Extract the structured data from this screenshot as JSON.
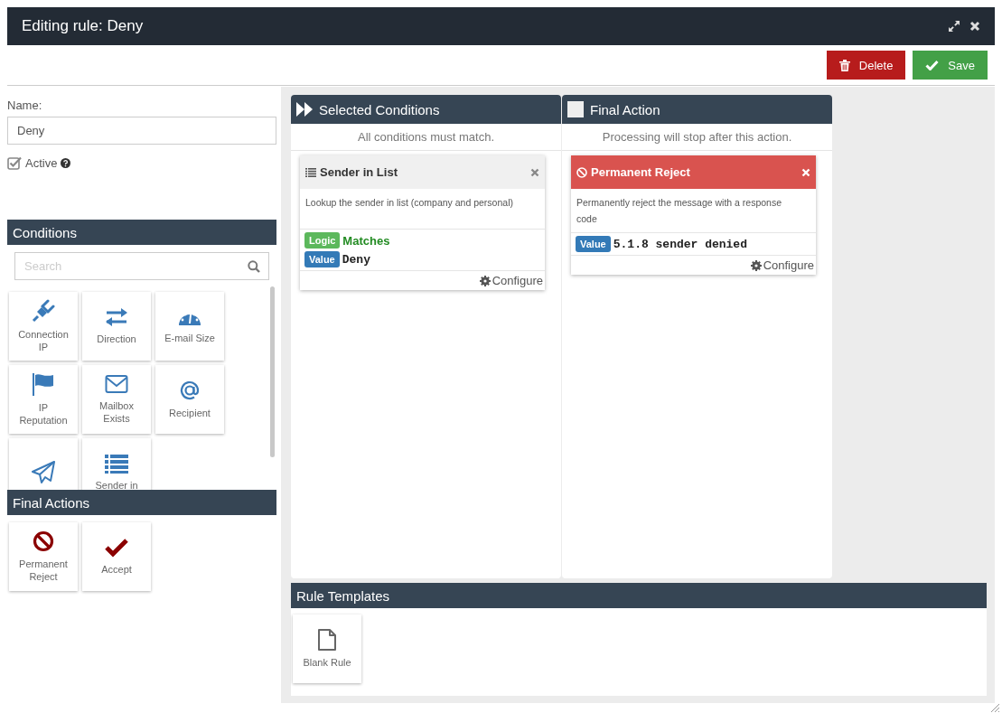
{
  "window": {
    "title": "Editing rule: Deny"
  },
  "toolbar": {
    "buttons": [
      {
        "label": "Delete",
        "kind": "danger"
      },
      {
        "label": "Save",
        "kind": "success"
      }
    ]
  },
  "form": {
    "name_label": "Name:",
    "name_value": "Deny",
    "active": {
      "label": "Active",
      "checked": true
    }
  },
  "conditions_panel": {
    "title": "Conditions",
    "search": {
      "placeholder": "Search"
    },
    "items": [
      {
        "label": "Connection IP",
        "label_hidden": false
      },
      {
        "label": "Direction",
        "label_hidden": false
      },
      {
        "label": "E-mail Size",
        "label_hidden": false
      },
      {
        "label": "IP Reputation",
        "label_hidden": false
      },
      {
        "label": "Mailbox Exists",
        "label_hidden": false
      },
      {
        "label": "Recipient",
        "label_hidden": false
      },
      {
        "label_hidden": true
      },
      {
        "label": "Sender in",
        "label_hidden": false
      }
    ]
  },
  "final_actions_panel": {
    "title": "Final Actions",
    "items": [
      "Permanent Reject",
      "Accept"
    ]
  },
  "selected_conditions": {
    "title": "Selected Conditions",
    "hint": "All conditions must match.",
    "cards": [
      {
        "kind": "condition",
        "title": "Sender in List",
        "description": "Lookup the sender in list (company and personal)",
        "params": [
          {
            "kind": "logic",
            "badge": "Logic",
            "value": "Matches"
          },
          {
            "kind": "value",
            "badge": "Value",
            "value": "Deny"
          }
        ],
        "configure": "Configure"
      }
    ]
  },
  "final_action": {
    "title": "Final Action",
    "hint": "Processing will stop after this action.",
    "cards": [
      {
        "kind": "action",
        "title": "Permanent Reject",
        "description": "Permanently reject the message with a response code",
        "params": [
          {
            "kind": "value",
            "badge": "Value",
            "value": "5.1.8 sender denied"
          }
        ],
        "configure": "Configure"
      }
    ]
  },
  "rule_templates": {
    "title": "Rule Templates",
    "items": [
      "Blank Rule"
    ]
  }
}
